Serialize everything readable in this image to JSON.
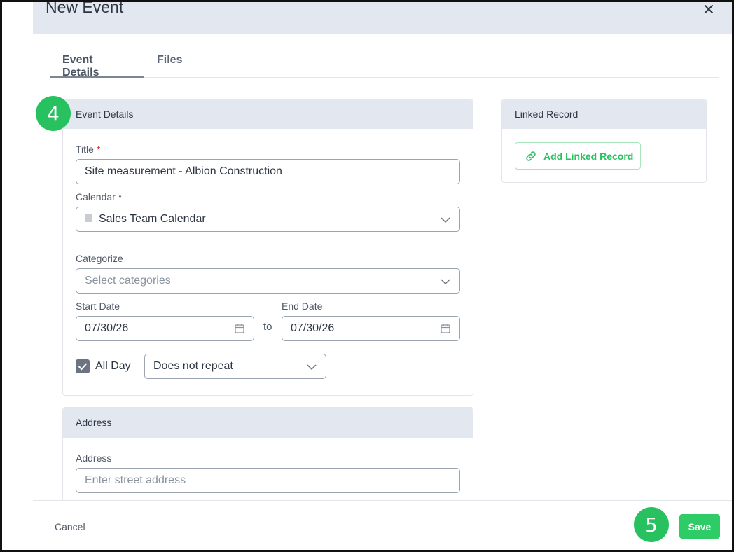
{
  "header": {
    "title": "New Event"
  },
  "tabs": [
    {
      "label": "Event Details",
      "active": true
    },
    {
      "label": "Files",
      "active": false
    }
  ],
  "event_details": {
    "heading": "Event Details",
    "title_label": "Title",
    "title_required_mark": "*",
    "title_value": "Site measurement - Albion Construction",
    "calendar_label": "Calendar *",
    "calendar_value": "Sales Team Calendar",
    "categorize_label": "Categorize",
    "categorize_placeholder": "Select categories",
    "start_date_label": "Start Date",
    "start_date_value": "07/30/26",
    "to_label": "to",
    "end_date_label": "End Date",
    "end_date_value": "07/30/26",
    "all_day_label": "All Day",
    "all_day_checked": true,
    "repeat_value": "Does not repeat"
  },
  "address": {
    "heading": "Address",
    "field_label": "Address",
    "placeholder": "Enter street address"
  },
  "linked_record": {
    "heading": "Linked Record",
    "add_button_label": "Add Linked Record"
  },
  "footer": {
    "cancel_label": "Cancel",
    "save_label": "Save"
  },
  "badges": {
    "step_4": "4",
    "step_5": "5"
  },
  "colors": {
    "accent_green": "#2ecc66",
    "header_bg": "#e3e8f0",
    "required_red": "#d0342c"
  }
}
